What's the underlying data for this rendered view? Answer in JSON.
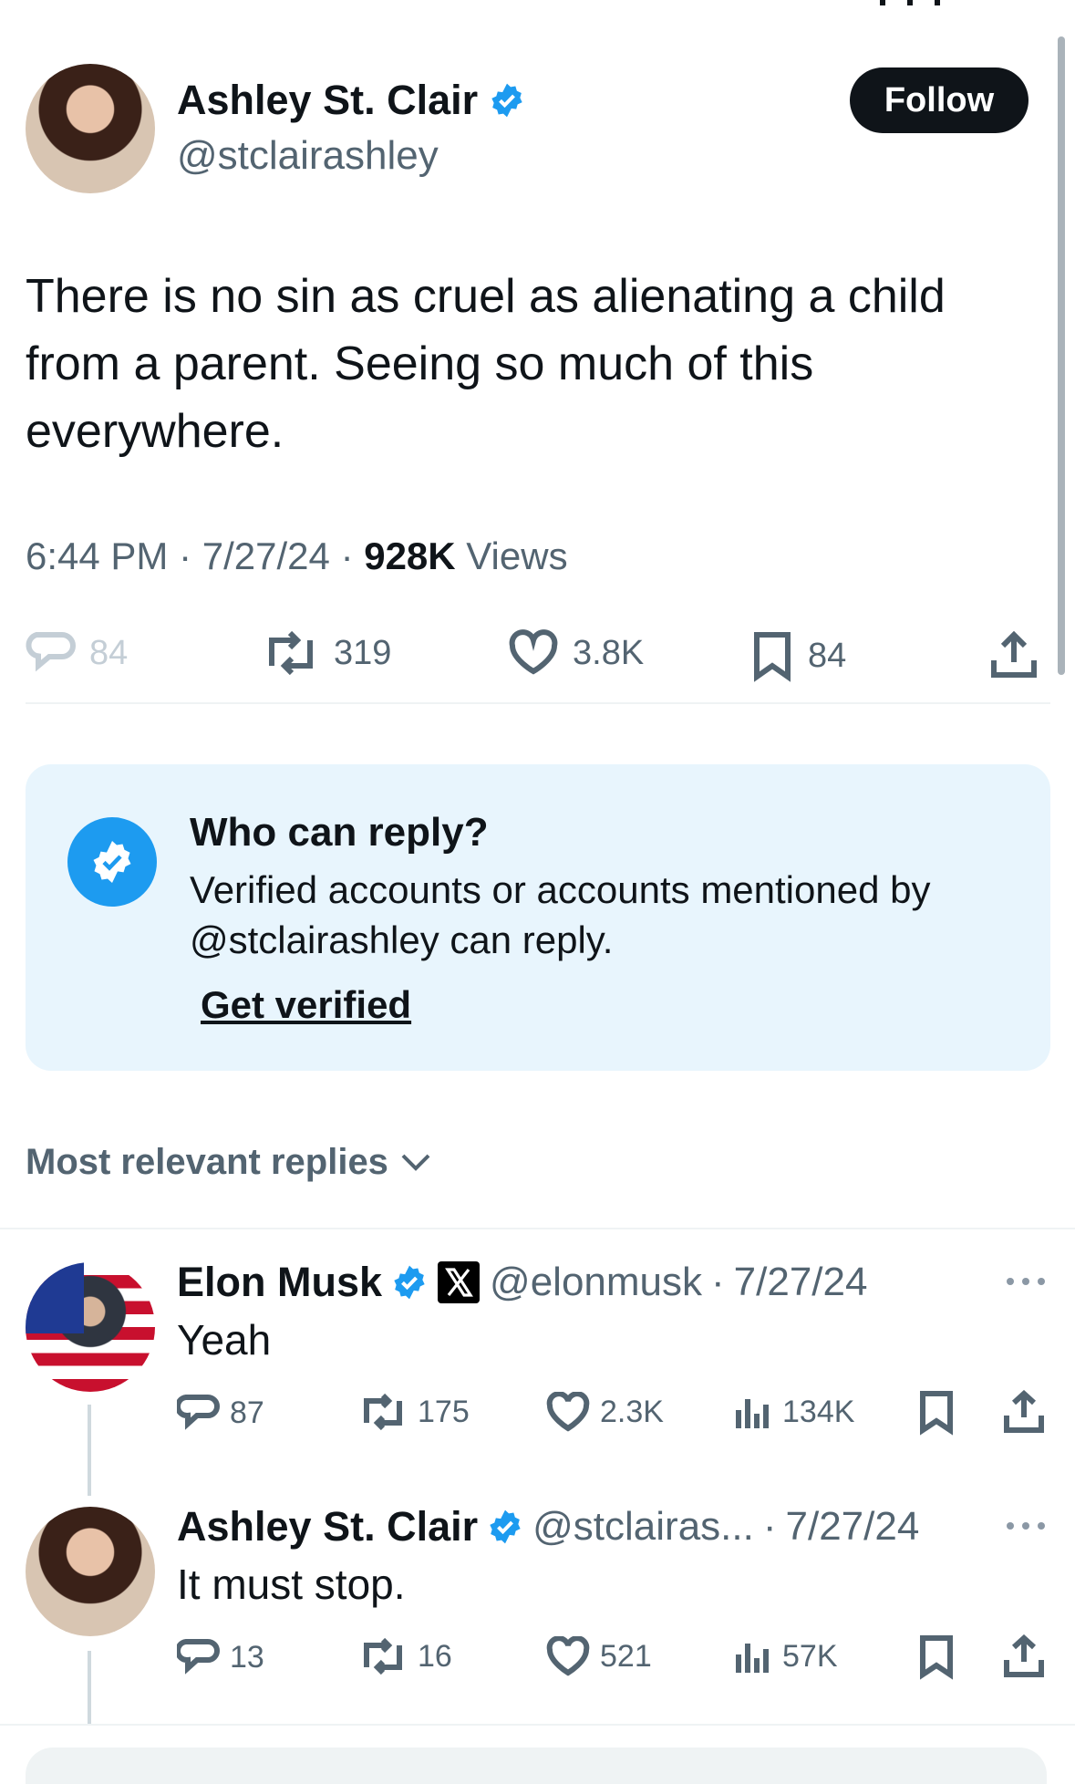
{
  "post": {
    "author_name": "Ashley St. Clair",
    "author_handle": "@stclairashley",
    "follow_label": "Follow",
    "text": "There is no sin as cruel as alienating a child from a parent. Seeing so much of this everywhere.",
    "time": "6:44 PM",
    "date": "7/27/24",
    "views_count": "928K",
    "views_label": "Views",
    "replies": "84",
    "reposts": "319",
    "likes": "3.8K",
    "bookmarks": "84"
  },
  "reply_notice": {
    "title": "Who can reply?",
    "body": "Verified accounts or accounts mentioned by @stclairashley can reply.",
    "cta": "Get verified"
  },
  "sort": {
    "label": "Most relevant replies"
  },
  "replies": [
    {
      "name": "Elon Musk",
      "handle": "@elonmusk",
      "sep": "·",
      "date": "7/27/24",
      "text": "Yeah",
      "replies": "87",
      "reposts": "175",
      "likes": "2.3K",
      "views": "134K"
    },
    {
      "name": "Ashley St. Clair",
      "handle": "@stclairas...",
      "sep": "·",
      "date": "7/27/24",
      "text": "It must stop.",
      "replies": "13",
      "reposts": "16",
      "likes": "521",
      "views": "57K"
    }
  ],
  "colors": {
    "accent": "#1d9bf0",
    "notice_bg": "#e8f5fd",
    "secondary_text": "#536471"
  }
}
